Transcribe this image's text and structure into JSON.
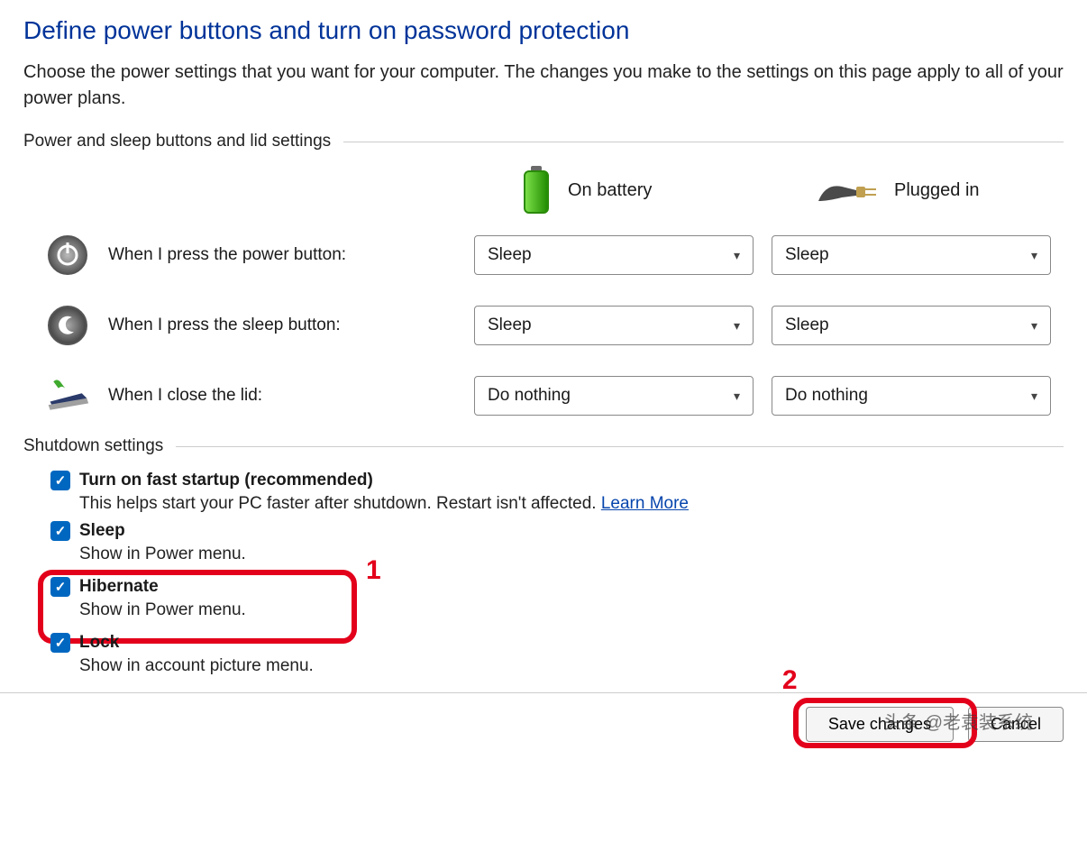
{
  "page": {
    "title": "Define power buttons and turn on password protection",
    "description": "Choose the power settings that you want for your computer. The changes you make to the settings on this page apply to all of your power plans."
  },
  "section1": {
    "header": "Power and sleep buttons and lid settings",
    "col_battery": "On battery",
    "col_plugged": "Plugged in",
    "rows": [
      {
        "label": "When I press the power button:",
        "battery": "Sleep",
        "plugged": "Sleep"
      },
      {
        "label": "When I press the sleep button:",
        "battery": "Sleep",
        "plugged": "Sleep"
      },
      {
        "label": "When I close the lid:",
        "battery": "Do nothing",
        "plugged": "Do nothing"
      }
    ]
  },
  "section2": {
    "header": "Shutdown settings",
    "items": [
      {
        "label": "Turn on fast startup (recommended)",
        "desc": "This helps start your PC faster after shutdown. Restart isn't affected. ",
        "link": "Learn More"
      },
      {
        "label": "Sleep",
        "desc": "Show in Power menu."
      },
      {
        "label": "Hibernate",
        "desc": "Show in Power menu."
      },
      {
        "label": "Lock",
        "desc": "Show in account picture menu."
      }
    ]
  },
  "buttons": {
    "save": "Save changes",
    "cancel": "Cancel"
  },
  "annotations": {
    "num1": "1",
    "num2": "2"
  },
  "watermark": "头条 @老袁装系统"
}
